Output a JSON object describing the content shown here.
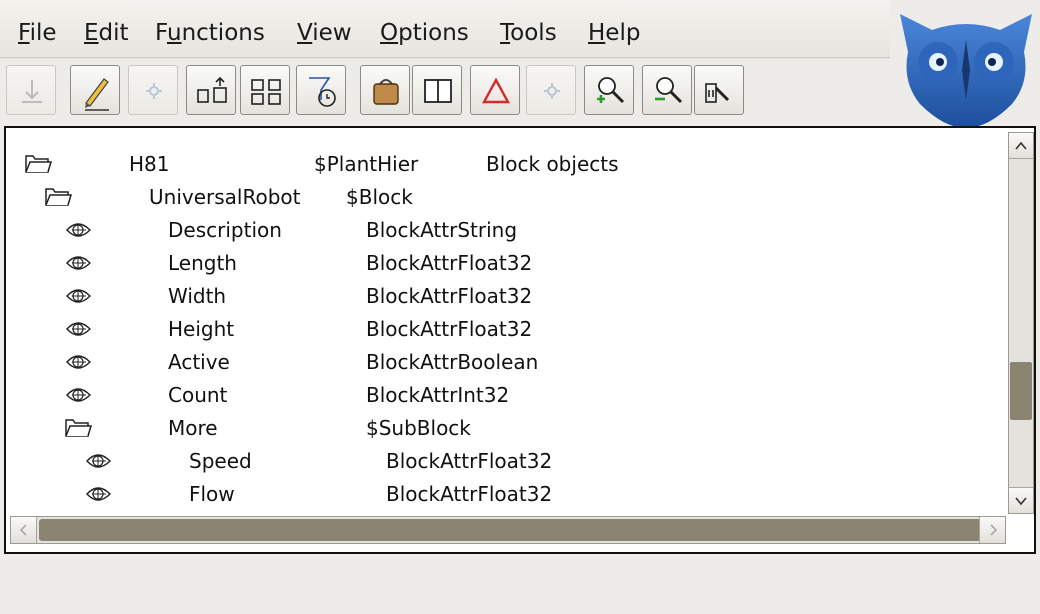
{
  "menu": {
    "items": [
      {
        "accel": "F",
        "rest": "ile"
      },
      {
        "accel": "E",
        "rest": "dit"
      },
      {
        "pre": "F",
        "accel": "u",
        "rest": "nctions"
      },
      {
        "accel": "V",
        "rest": "iew"
      },
      {
        "accel": "O",
        "rest": "ptions"
      },
      {
        "accel": "T",
        "rest": "ools"
      },
      {
        "accel": "H",
        "rest": "elp"
      }
    ]
  },
  "toolbar": {
    "buttons": [
      {
        "icon": "download-icon",
        "enabled": false
      },
      {
        "icon": "pencil-icon",
        "enabled": true
      },
      {
        "icon": "gear-small-icon",
        "enabled": false
      },
      {
        "icon": "hierarchy-up-icon",
        "enabled": true
      },
      {
        "icon": "block-tree-icon",
        "enabled": true
      },
      {
        "icon": "filter-time-icon",
        "enabled": true
      },
      {
        "icon": "bag-icon",
        "enabled": true
      },
      {
        "icon": "split-view-icon",
        "enabled": true
      },
      {
        "icon": "triangle-warning-icon",
        "enabled": true
      },
      {
        "icon": "gear-small-icon",
        "enabled": false
      },
      {
        "icon": "zoom-in-icon",
        "enabled": true
      },
      {
        "icon": "zoom-out-icon",
        "enabled": true
      },
      {
        "icon": "zoom-reset-icon",
        "enabled": true
      }
    ]
  },
  "tree": {
    "rows": [
      {
        "icon": "folder-open-icon",
        "name": "H81",
        "class": "$PlantHier",
        "desc": "Block objects",
        "level": 0
      },
      {
        "icon": "folder-open-icon",
        "name": "UniversalRobot",
        "class": "$Block",
        "desc": "",
        "level": 1
      },
      {
        "icon": "leaf-icon",
        "name": "Description",
        "class": "BlockAttrString",
        "desc": "",
        "level": 2
      },
      {
        "icon": "leaf-icon",
        "name": "Length",
        "class": "BlockAttrFloat32",
        "desc": "",
        "level": 2
      },
      {
        "icon": "leaf-icon",
        "name": "Width",
        "class": "BlockAttrFloat32",
        "desc": "",
        "level": 2
      },
      {
        "icon": "leaf-icon",
        "name": "Height",
        "class": "BlockAttrFloat32",
        "desc": "",
        "level": 2
      },
      {
        "icon": "leaf-icon",
        "name": "Active",
        "class": "BlockAttrBoolean",
        "desc": "",
        "level": 2
      },
      {
        "icon": "leaf-icon",
        "name": "Count",
        "class": "BlockAttrInt32",
        "desc": "",
        "level": 2
      },
      {
        "icon": "folder-open-icon",
        "name": "More",
        "class": "$SubBlock",
        "desc": "",
        "level": 2
      },
      {
        "icon": "leaf-icon",
        "name": "Speed",
        "class": "BlockAttrFloat32",
        "desc": "",
        "level": 3
      },
      {
        "icon": "leaf-icon",
        "name": "Flow",
        "class": "BlockAttrFloat32",
        "desc": "",
        "level": 3
      }
    ]
  },
  "scroll": {
    "vertical_position": 0.75
  }
}
